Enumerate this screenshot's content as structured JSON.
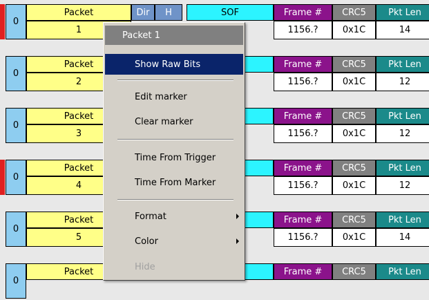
{
  "headers": {
    "packet": "Packet",
    "dir": "Dir",
    "h": "H",
    "sof": "SOF",
    "frame": "Frame #",
    "crc5": "CRC5",
    "pkt_len": "Pkt Len"
  },
  "packets": [
    {
      "num": "0",
      "index": "1",
      "frame": "1156.?",
      "crc5": "0x1C",
      "len": "14",
      "marked": true
    },
    {
      "num": "0",
      "index": "2",
      "frame": "1156.?",
      "crc5": "0x1C",
      "len": "12",
      "marked": false
    },
    {
      "num": "0",
      "index": "3",
      "frame": "1156.?",
      "crc5": "0x1C",
      "len": "12",
      "marked": false
    },
    {
      "num": "0",
      "index": "4",
      "frame": "1156.?",
      "crc5": "0x1C",
      "len": "12",
      "marked": true
    },
    {
      "num": "0",
      "index": "5",
      "frame": "1156.?",
      "crc5": "0x1C",
      "len": "14",
      "marked": false
    },
    {
      "num": "0",
      "index": "",
      "frame": "",
      "crc5": "",
      "len": "",
      "marked": false
    }
  ],
  "context_menu": {
    "title": "Packet 1",
    "items": [
      {
        "label": "Show Raw Bits",
        "selected": true
      },
      {
        "label": "Edit marker"
      },
      {
        "label": "Clear marker"
      },
      {
        "label": "Time From Trigger"
      },
      {
        "label": "Time From Marker"
      },
      {
        "label": "Format",
        "submenu": true
      },
      {
        "label": "Color",
        "submenu": true
      },
      {
        "label": "Hide",
        "disabled": true
      }
    ]
  },
  "colors": {
    "marker": "#e02020",
    "packet_bg": "#ffff88",
    "sof_bg": "#2cf4ff",
    "frame_bg": "#8b138b",
    "crc_bg": "#808080",
    "len_bg": "#1b8a8a",
    "selection": "#0a246a"
  }
}
